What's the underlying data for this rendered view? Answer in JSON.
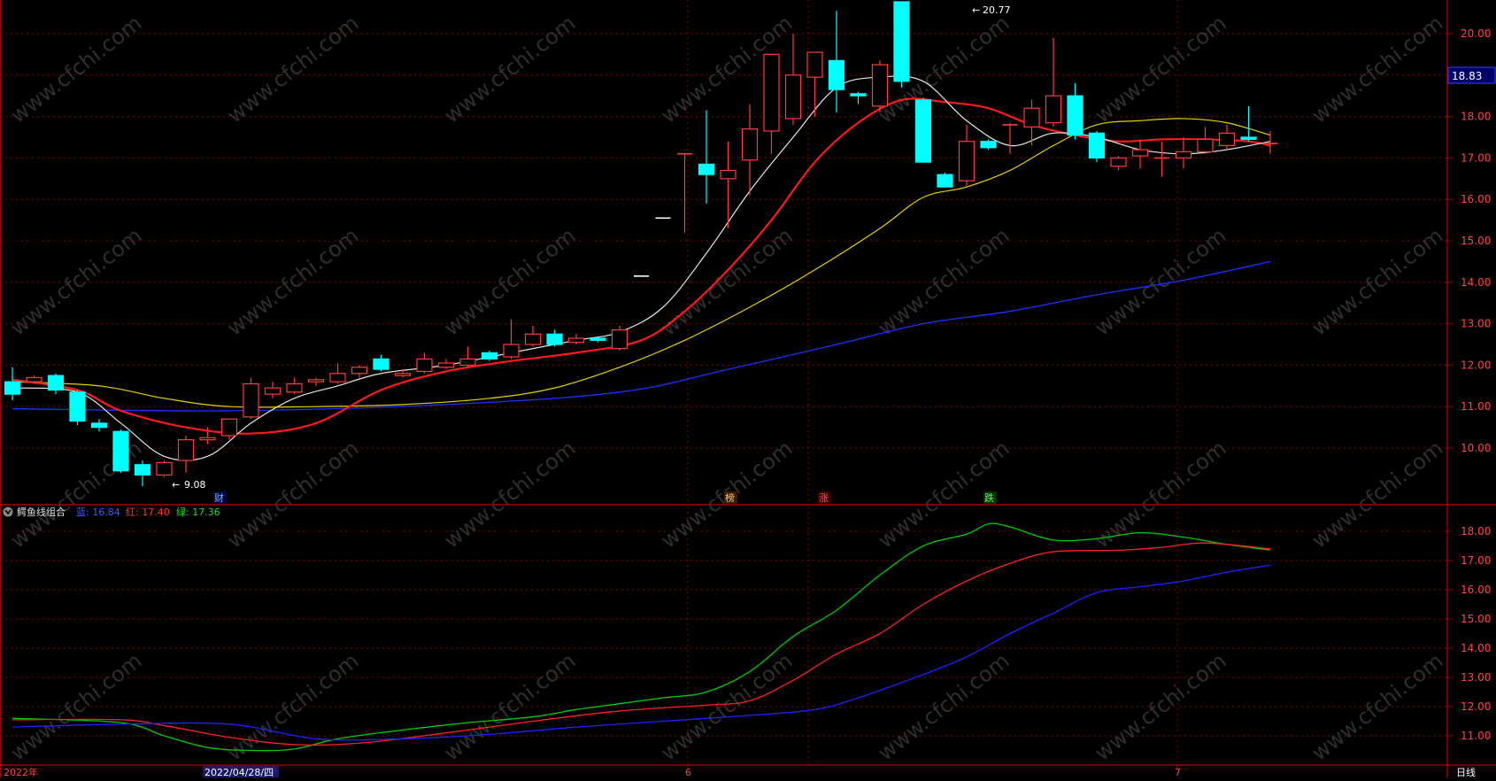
{
  "watermark": "www.cfchi.com",
  "price_panel": {
    "current_price": "18.83",
    "high_label": "20.77",
    "low_label": "9.08",
    "axis_ticks": [
      "20.00",
      "19.00",
      "18.00",
      "17.00",
      "16.00",
      "15.00",
      "14.00",
      "13.00",
      "12.00",
      "11.00",
      "10.00"
    ],
    "event_markers": [
      "财",
      "榜",
      "涨",
      "跌"
    ]
  },
  "indicator_panel": {
    "name": "鳄鱼线组合",
    "blue_label": "蓝: 16.84",
    "red_label": "红: 17.40",
    "green_label": "绿: 17.36",
    "axis_ticks": [
      "18.00",
      "17.00",
      "16.00",
      "15.00",
      "14.00",
      "13.00",
      "12.00",
      "11.00"
    ]
  },
  "time_axis": {
    "labels": [
      "2022年",
      "2022/04/28/四",
      "6",
      "7"
    ],
    "period": "日线"
  },
  "colors": {
    "up": "#ff3b3b",
    "down": "#00ffff",
    "ma_white": "#e6e6e6",
    "ma_red": "#ff1a1a",
    "ma_yellow": "#e6d000",
    "ma_blue": "#1a33ff",
    "ind_green": "#00cc00",
    "ind_red": "#ff2020",
    "ind_blue": "#2020ff",
    "grid": "#8a0000"
  },
  "chart_data": [
    {
      "type": "candlestick",
      "title": "",
      "y_range": [
        9.0,
        21.0
      ],
      "candles": [
        [
          11.6,
          11.3,
          11.95,
          11.15
        ],
        [
          11.6,
          11.7,
          11.75,
          11.55
        ],
        [
          11.75,
          11.4,
          11.8,
          11.3
        ],
        [
          11.35,
          10.65,
          11.4,
          10.55
        ],
        [
          10.6,
          10.5,
          10.7,
          10.4
        ],
        [
          10.4,
          9.45,
          10.45,
          9.4
        ],
        [
          9.6,
          9.35,
          9.7,
          9.08
        ],
        [
          9.35,
          9.65,
          9.7,
          9.3
        ],
        [
          9.7,
          10.2,
          10.3,
          9.4
        ],
        [
          10.2,
          10.25,
          10.5,
          10.1
        ],
        [
          10.3,
          10.7,
          10.7,
          10.2
        ],
        [
          10.75,
          11.55,
          11.7,
          10.7
        ],
        [
          11.3,
          11.45,
          11.6,
          11.2
        ],
        [
          11.35,
          11.55,
          11.7,
          11.3
        ],
        [
          11.6,
          11.65,
          11.7,
          11.5
        ],
        [
          11.6,
          11.8,
          12.05,
          11.55
        ],
        [
          11.8,
          11.95,
          12.0,
          11.7
        ],
        [
          12.15,
          11.9,
          12.25,
          11.85
        ],
        [
          11.75,
          11.8,
          11.9,
          11.7
        ],
        [
          11.85,
          12.15,
          12.3,
          11.8
        ],
        [
          11.95,
          12.05,
          12.15,
          11.9
        ],
        [
          12.0,
          12.15,
          12.45,
          11.95
        ],
        [
          12.3,
          12.15,
          12.35,
          12.1
        ],
        [
          12.2,
          12.5,
          13.1,
          12.15
        ],
        [
          12.5,
          12.75,
          12.95,
          12.45
        ],
        [
          12.75,
          12.5,
          12.85,
          12.45
        ],
        [
          12.55,
          12.65,
          12.75,
          12.5
        ],
        [
          12.65,
          12.6,
          12.7,
          12.55
        ],
        [
          12.4,
          12.85,
          12.95,
          12.35
        ],
        [
          14.15,
          14.15,
          14.15,
          14.15
        ],
        [
          15.55,
          15.55,
          15.55,
          15.55
        ],
        [
          17.1,
          17.1,
          17.1,
          15.2
        ],
        [
          16.85,
          16.6,
          18.15,
          15.9
        ],
        [
          16.5,
          16.7,
          17.4,
          15.3
        ],
        [
          16.95,
          17.7,
          18.3,
          16.1
        ],
        [
          17.65,
          19.5,
          19.5,
          17.1
        ],
        [
          17.95,
          19.0,
          20.0,
          17.8
        ],
        [
          18.95,
          19.55,
          19.55,
          18.0
        ],
        [
          19.35,
          18.65,
          20.55,
          18.1
        ],
        [
          18.55,
          18.5,
          18.6,
          18.3
        ],
        [
          18.25,
          19.25,
          19.35,
          18.1
        ],
        [
          20.77,
          18.85,
          20.77,
          18.7
        ],
        [
          18.4,
          16.9,
          18.45,
          16.9
        ],
        [
          16.6,
          16.3,
          16.65,
          16.3
        ],
        [
          16.45,
          17.4,
          17.8,
          16.3
        ],
        [
          17.4,
          17.25,
          17.45,
          17.2
        ],
        [
          17.8,
          17.8,
          17.85,
          17.1
        ],
        [
          17.75,
          18.2,
          18.4,
          17.3
        ],
        [
          17.85,
          18.5,
          19.9,
          17.75
        ],
        [
          18.5,
          17.55,
          18.8,
          17.45
        ],
        [
          17.6,
          17.0,
          17.65,
          16.9
        ],
        [
          16.8,
          17.0,
          17.05,
          16.7
        ],
        [
          17.05,
          17.2,
          17.45,
          16.75
        ],
        [
          17.0,
          17.0,
          17.4,
          16.55
        ],
        [
          17.0,
          17.15,
          17.5,
          16.75
        ],
        [
          17.15,
          17.45,
          17.75,
          17.1
        ],
        [
          17.3,
          17.6,
          17.8,
          17.2
        ],
        [
          17.5,
          17.45,
          18.25,
          17.4
        ],
        [
          17.35,
          17.35,
          17.65,
          17.1
        ]
      ],
      "ma_white": [
        [
          0,
          11.45
        ],
        [
          3,
          11.35
        ],
        [
          5,
          10.6
        ],
        [
          7,
          9.8
        ],
        [
          9,
          9.8
        ],
        [
          11,
          10.6
        ],
        [
          13,
          11.2
        ],
        [
          15,
          11.5
        ],
        [
          17,
          11.8
        ],
        [
          20,
          12.0
        ],
        [
          23,
          12.3
        ],
        [
          26,
          12.6
        ],
        [
          28,
          12.8
        ],
        [
          30,
          13.4
        ],
        [
          32,
          14.7
        ],
        [
          34,
          16.2
        ],
        [
          36,
          17.5
        ],
        [
          38,
          18.7
        ],
        [
          40,
          18.95
        ],
        [
          42,
          18.85
        ],
        [
          44,
          17.9
        ],
        [
          46,
          17.3
        ],
        [
          48,
          17.6
        ],
        [
          50,
          17.5
        ],
        [
          52,
          17.2
        ],
        [
          54,
          17.1
        ],
        [
          56,
          17.2
        ],
        [
          58,
          17.4
        ]
      ],
      "ma_red": [
        [
          0,
          11.65
        ],
        [
          3,
          11.4
        ],
        [
          5,
          10.9
        ],
        [
          8,
          10.5
        ],
        [
          11,
          10.35
        ],
        [
          14,
          10.6
        ],
        [
          17,
          11.4
        ],
        [
          20,
          11.85
        ],
        [
          23,
          12.1
        ],
        [
          26,
          12.3
        ],
        [
          29,
          12.6
        ],
        [
          31,
          13.3
        ],
        [
          33,
          14.3
        ],
        [
          35,
          15.5
        ],
        [
          37,
          16.9
        ],
        [
          39,
          17.85
        ],
        [
          41,
          18.4
        ],
        [
          43,
          18.35
        ],
        [
          45,
          18.2
        ],
        [
          47,
          17.8
        ],
        [
          49,
          17.55
        ],
        [
          51,
          17.4
        ],
        [
          53,
          17.45
        ],
        [
          55,
          17.45
        ],
        [
          57,
          17.4
        ],
        [
          58,
          17.3
        ]
      ],
      "ma_yellow": [
        [
          0,
          11.6
        ],
        [
          4,
          11.5
        ],
        [
          7,
          11.2
        ],
        [
          10,
          11.0
        ],
        [
          14,
          11.0
        ],
        [
          18,
          11.05
        ],
        [
          22,
          11.2
        ],
        [
          25,
          11.45
        ],
        [
          28,
          11.95
        ],
        [
          31,
          12.6
        ],
        [
          34,
          13.4
        ],
        [
          37,
          14.3
        ],
        [
          40,
          15.3
        ],
        [
          42,
          16.05
        ],
        [
          44,
          16.3
        ],
        [
          46,
          16.7
        ],
        [
          48,
          17.3
        ],
        [
          50,
          17.8
        ],
        [
          52,
          17.9
        ],
        [
          54,
          17.95
        ],
        [
          56,
          17.85
        ],
        [
          58,
          17.55
        ]
      ],
      "ma_blue": [
        [
          0,
          10.95
        ],
        [
          10,
          10.9
        ],
        [
          20,
          11.05
        ],
        [
          28,
          11.35
        ],
        [
          33,
          11.9
        ],
        [
          38,
          12.5
        ],
        [
          42,
          13.0
        ],
        [
          46,
          13.3
        ],
        [
          50,
          13.7
        ],
        [
          54,
          14.05
        ],
        [
          58,
          14.5
        ]
      ]
    },
    {
      "type": "line",
      "title": "鳄鱼线组合",
      "y_range": [
        10.6,
        18.5
      ],
      "series": [
        {
          "name": "绿",
          "points": [
            [
              0,
              11.6
            ],
            [
              5,
              11.45
            ],
            [
              7,
              11.0
            ],
            [
              9,
              10.6
            ],
            [
              11,
              10.5
            ],
            [
              13,
              10.55
            ],
            [
              15,
              10.9
            ],
            [
              18,
              11.2
            ],
            [
              21,
              11.45
            ],
            [
              24,
              11.65
            ],
            [
              26,
              11.9
            ],
            [
              28,
              12.1
            ],
            [
              30,
              12.3
            ],
            [
              32,
              12.5
            ],
            [
              34,
              13.2
            ],
            [
              36,
              14.4
            ],
            [
              38,
              15.3
            ],
            [
              40,
              16.5
            ],
            [
              42,
              17.5
            ],
            [
              44,
              17.9
            ],
            [
              45,
              18.25
            ],
            [
              46,
              18.15
            ],
            [
              48,
              17.7
            ],
            [
              50,
              17.75
            ],
            [
              52,
              17.95
            ],
            [
              54,
              17.8
            ],
            [
              56,
              17.55
            ],
            [
              58,
              17.36
            ]
          ]
        },
        {
          "name": "红",
          "points": [
            [
              0,
              11.55
            ],
            [
              5,
              11.55
            ],
            [
              7,
              11.35
            ],
            [
              10,
              10.95
            ],
            [
              13,
              10.7
            ],
            [
              16,
              10.75
            ],
            [
              20,
              11.1
            ],
            [
              24,
              11.5
            ],
            [
              28,
              11.85
            ],
            [
              32,
              12.05
            ],
            [
              34,
              12.2
            ],
            [
              36,
              12.9
            ],
            [
              38,
              13.8
            ],
            [
              40,
              14.5
            ],
            [
              42,
              15.5
            ],
            [
              44,
              16.3
            ],
            [
              46,
              16.9
            ],
            [
              48,
              17.3
            ],
            [
              51,
              17.35
            ],
            [
              53,
              17.45
            ],
            [
              55,
              17.6
            ],
            [
              58,
              17.4
            ]
          ]
        },
        {
          "name": "蓝",
          "points": [
            [
              0,
              11.3
            ],
            [
              5,
              11.4
            ],
            [
              10,
              11.4
            ],
            [
              14,
              10.9
            ],
            [
              18,
              10.9
            ],
            [
              22,
              11.05
            ],
            [
              26,
              11.3
            ],
            [
              30,
              11.5
            ],
            [
              34,
              11.7
            ],
            [
              37,
              11.9
            ],
            [
              39,
              12.3
            ],
            [
              42,
              13.1
            ],
            [
              44,
              13.7
            ],
            [
              46,
              14.5
            ],
            [
              48,
              15.2
            ],
            [
              50,
              15.9
            ],
            [
              52,
              16.1
            ],
            [
              54,
              16.3
            ],
            [
              56,
              16.6
            ],
            [
              58,
              16.84
            ]
          ]
        }
      ]
    }
  ]
}
